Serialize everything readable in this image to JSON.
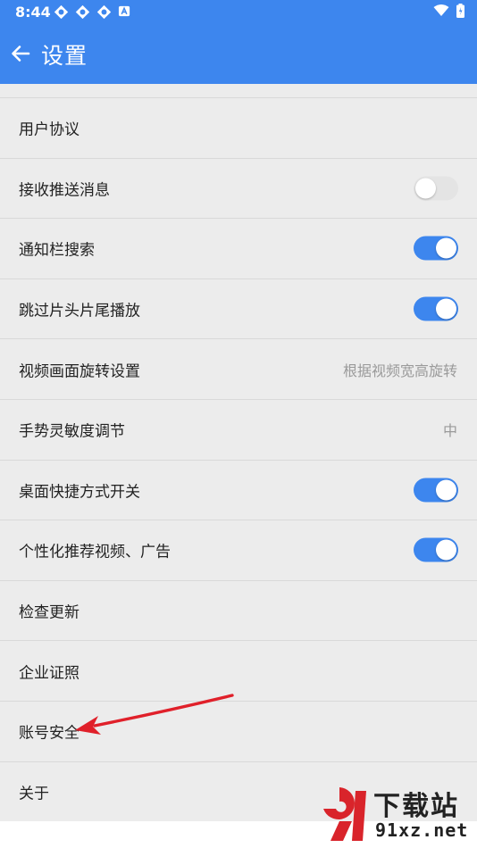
{
  "status": {
    "time": "8:44"
  },
  "header": {
    "title": "设置"
  },
  "settings": [
    {
      "label": "用户协议"
    },
    {
      "label": "接收推送消息",
      "toggle": false
    },
    {
      "label": "通知栏搜索",
      "toggle": true
    },
    {
      "label": "跳过片头片尾播放",
      "toggle": true
    },
    {
      "label": "视频画面旋转设置",
      "value": "根据视频宽高旋转"
    },
    {
      "label": "手势灵敏度调节",
      "value": "中"
    },
    {
      "label": "桌面快捷方式开关",
      "toggle": true
    },
    {
      "label": "个性化推荐视频、广告",
      "toggle": true
    },
    {
      "label": "检查更新"
    },
    {
      "label": "企业证照"
    },
    {
      "label": "账号安全"
    },
    {
      "label": "关于"
    }
  ],
  "watermark": {
    "brand": "下载站",
    "site": "91xz.net"
  },
  "colors": {
    "accent": "#3d86ee",
    "arrow": "#e0202a"
  }
}
